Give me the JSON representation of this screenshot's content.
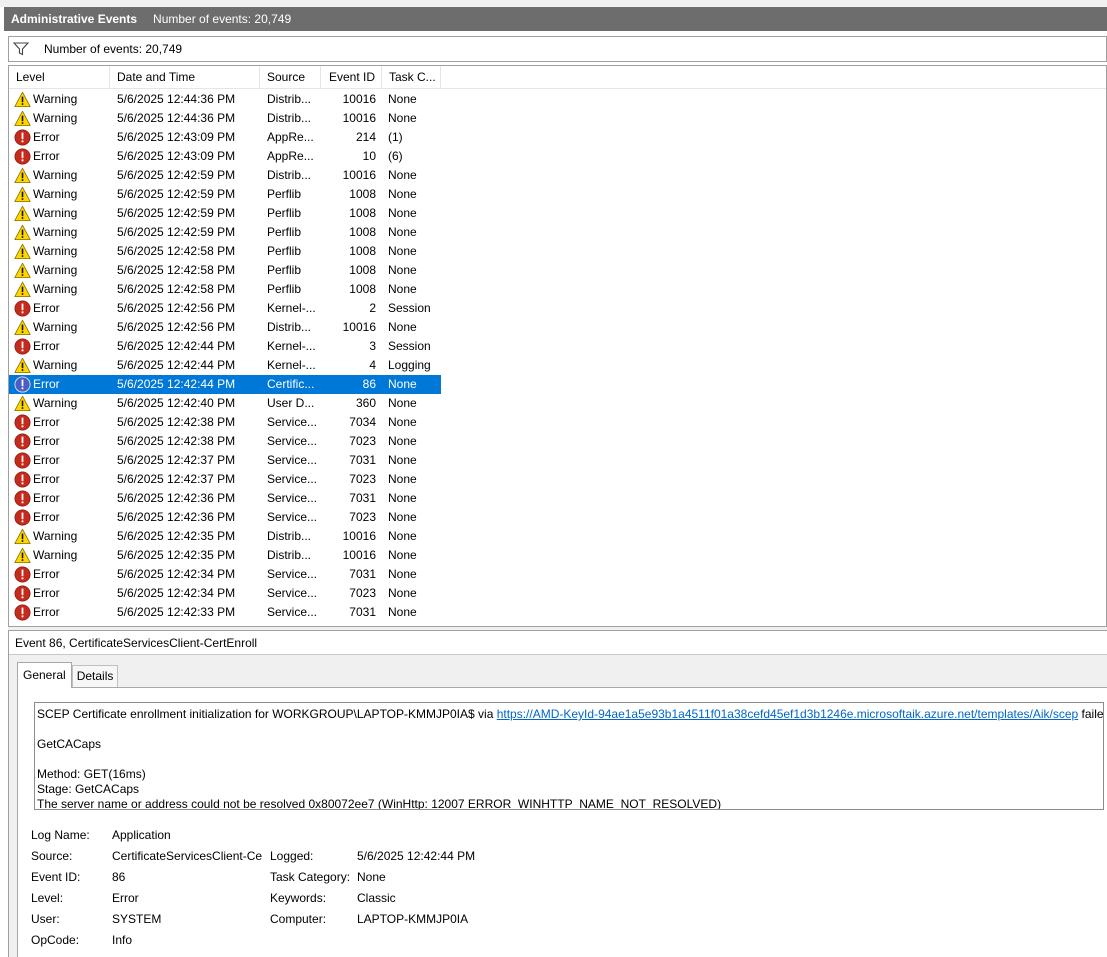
{
  "title": {
    "name": "Administrative Events",
    "count": "Number of events: 20,749"
  },
  "filter": {
    "text": "Number of events: 20,749"
  },
  "columns": [
    "Level",
    "Date and Time",
    "Source",
    "Event ID",
    "Task C..."
  ],
  "rows": [
    {
      "icon": "warning",
      "level": "Warning",
      "date": "5/6/2025 12:44:36 PM",
      "source": "Distrib...",
      "id": "10016",
      "task": "None"
    },
    {
      "icon": "warning",
      "level": "Warning",
      "date": "5/6/2025 12:44:36 PM",
      "source": "Distrib...",
      "id": "10016",
      "task": "None"
    },
    {
      "icon": "error",
      "level": "Error",
      "date": "5/6/2025 12:43:09 PM",
      "source": "AppRe...",
      "id": "214",
      "task": "(1)"
    },
    {
      "icon": "error",
      "level": "Error",
      "date": "5/6/2025 12:43:09 PM",
      "source": "AppRe...",
      "id": "10",
      "task": "(6)"
    },
    {
      "icon": "warning",
      "level": "Warning",
      "date": "5/6/2025 12:42:59 PM",
      "source": "Distrib...",
      "id": "10016",
      "task": "None"
    },
    {
      "icon": "warning",
      "level": "Warning",
      "date": "5/6/2025 12:42:59 PM",
      "source": "Perflib",
      "id": "1008",
      "task": "None"
    },
    {
      "icon": "warning",
      "level": "Warning",
      "date": "5/6/2025 12:42:59 PM",
      "source": "Perflib",
      "id": "1008",
      "task": "None"
    },
    {
      "icon": "warning",
      "level": "Warning",
      "date": "5/6/2025 12:42:59 PM",
      "source": "Perflib",
      "id": "1008",
      "task": "None"
    },
    {
      "icon": "warning",
      "level": "Warning",
      "date": "5/6/2025 12:42:58 PM",
      "source": "Perflib",
      "id": "1008",
      "task": "None"
    },
    {
      "icon": "warning",
      "level": "Warning",
      "date": "5/6/2025 12:42:58 PM",
      "source": "Perflib",
      "id": "1008",
      "task": "None"
    },
    {
      "icon": "warning",
      "level": "Warning",
      "date": "5/6/2025 12:42:58 PM",
      "source": "Perflib",
      "id": "1008",
      "task": "None"
    },
    {
      "icon": "error",
      "level": "Error",
      "date": "5/6/2025 12:42:56 PM",
      "source": "Kernel-...",
      "id": "2",
      "task": "Session"
    },
    {
      "icon": "warning",
      "level": "Warning",
      "date": "5/6/2025 12:42:56 PM",
      "source": "Distrib...",
      "id": "10016",
      "task": "None"
    },
    {
      "icon": "error",
      "level": "Error",
      "date": "5/6/2025 12:42:44 PM",
      "source": "Kernel-...",
      "id": "3",
      "task": "Session"
    },
    {
      "icon": "warning",
      "level": "Warning",
      "date": "5/6/2025 12:42:44 PM",
      "source": "Kernel-...",
      "id": "4",
      "task": "Logging"
    },
    {
      "icon": "error-selected",
      "level": "Error",
      "date": "5/6/2025 12:42:44 PM",
      "source": "Certific...",
      "id": "86",
      "task": "None",
      "selected": true
    },
    {
      "icon": "warning",
      "level": "Warning",
      "date": "5/6/2025 12:42:40 PM",
      "source": "User D...",
      "id": "360",
      "task": "None"
    },
    {
      "icon": "error",
      "level": "Error",
      "date": "5/6/2025 12:42:38 PM",
      "source": "Service...",
      "id": "7034",
      "task": "None"
    },
    {
      "icon": "error",
      "level": "Error",
      "date": "5/6/2025 12:42:38 PM",
      "source": "Service...",
      "id": "7023",
      "task": "None"
    },
    {
      "icon": "error",
      "level": "Error",
      "date": "5/6/2025 12:42:37 PM",
      "source": "Service...",
      "id": "7031",
      "task": "None"
    },
    {
      "icon": "error",
      "level": "Error",
      "date": "5/6/2025 12:42:37 PM",
      "source": "Service...",
      "id": "7023",
      "task": "None"
    },
    {
      "icon": "error",
      "level": "Error",
      "date": "5/6/2025 12:42:36 PM",
      "source": "Service...",
      "id": "7031",
      "task": "None"
    },
    {
      "icon": "error",
      "level": "Error",
      "date": "5/6/2025 12:42:36 PM",
      "source": "Service...",
      "id": "7023",
      "task": "None"
    },
    {
      "icon": "warning",
      "level": "Warning",
      "date": "5/6/2025 12:42:35 PM",
      "source": "Distrib...",
      "id": "10016",
      "task": "None"
    },
    {
      "icon": "warning",
      "level": "Warning",
      "date": "5/6/2025 12:42:35 PM",
      "source": "Distrib...",
      "id": "10016",
      "task": "None"
    },
    {
      "icon": "error",
      "level": "Error",
      "date": "5/6/2025 12:42:34 PM",
      "source": "Service...",
      "id": "7031",
      "task": "None"
    },
    {
      "icon": "error",
      "level": "Error",
      "date": "5/6/2025 12:42:34 PM",
      "source": "Service...",
      "id": "7023",
      "task": "None"
    },
    {
      "icon": "error",
      "level": "Error",
      "date": "5/6/2025 12:42:33 PM",
      "source": "Service...",
      "id": "7031",
      "task": "None"
    }
  ],
  "detail": {
    "title": "Event 86, CertificateServicesClient-CertEnroll",
    "tabs": {
      "general": "General",
      "details": "Details"
    },
    "message": {
      "line1_prefix": "SCEP Certificate enrollment initialization for WORKGROUP\\LAPTOP-KMMJP0IA$ via ",
      "link": "https://AMD-KeyId-94ae1a5e93b1a4511f01a38cefd45ef1d3b1246e.microsoftaik.azure.net/templates/Aik/scep",
      "line1_suffix": " failed:",
      "line2": "GetCACaps",
      "line3": "Method: GET(16ms)",
      "line4": "Stage: GetCACaps",
      "line5": "The server name or address could not be resolved 0x80072ee7 (WinHttp: 12007 ERROR_WINHTTP_NAME_NOT_RESOLVED)"
    },
    "fields": {
      "log_name_label": "Log Name:",
      "log_name": "Application",
      "source_label": "Source:",
      "source": "CertificateServicesClient-Cer",
      "logged_label": "Logged:",
      "logged": "5/6/2025 12:42:44 PM",
      "event_id_label": "Event ID:",
      "event_id": "86",
      "task_category_label": "Task Category:",
      "task_category": "None",
      "level_label": "Level:",
      "level": "Error",
      "keywords_label": "Keywords:",
      "keywords": "Classic",
      "user_label": "User:",
      "user": "SYSTEM",
      "computer_label": "Computer:",
      "computer": "LAPTOP-KMMJP0IA",
      "opcode_label": "OpCode:",
      "opcode": "Info"
    }
  },
  "colors": {
    "selection": "#0078d7",
    "error_red": "#c42b1c",
    "warning_yellow": "#ffd700",
    "titlebar": "#6d6d6d",
    "link": "#0066cc"
  }
}
